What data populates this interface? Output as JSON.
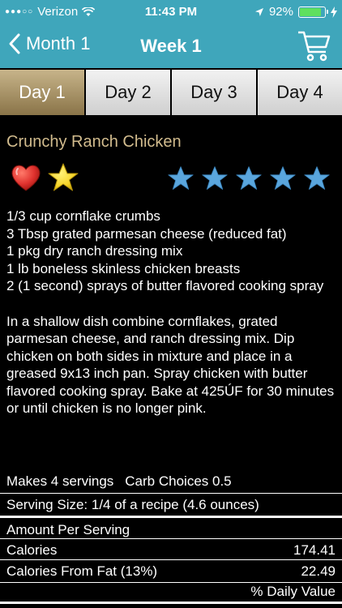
{
  "status_bar": {
    "carrier": "Verizon",
    "time": "11:43 PM",
    "battery": "92%",
    "battery_level": 0.92
  },
  "nav": {
    "back_label": "Month 1",
    "title": "Week 1",
    "icons": [
      "chevron-left-icon",
      "cart-icon"
    ]
  },
  "tabs": [
    {
      "label": "Day 1",
      "active": true
    },
    {
      "label": "Day 2",
      "active": false
    },
    {
      "label": "Day 3",
      "active": false
    },
    {
      "label": "Day 4",
      "active": false
    }
  ],
  "recipe": {
    "title": "Crunchy Ranch Chicken",
    "rating_stars": 5,
    "ingredients": [
      "1/3 cup cornflake crumbs",
      "3 Tbsp grated parmesan cheese (reduced fat)",
      "1 pkg dry ranch dressing mix",
      "1 lb boneless skinless chicken breasts",
      "2 (1 second) sprays of butter flavored cooking spray"
    ],
    "instructions": "In a shallow dish combine cornflakes, grated parmesan cheese, and ranch dressing mix. Dip chicken on both sides in mixture and place in a greased 9x13 inch pan.  Spray chicken with butter flavored cooking spray. Bake at 425ÚF for 30 minutes or until chicken is no longer pink.",
    "makes": "Makes 4 servings",
    "carb_choices": "Carb Choices 0.5"
  },
  "nutrition": {
    "serving_size": "Serving Size: 1/4 of a recipe (4.6 ounces)",
    "amount_header": "Amount Per Serving",
    "calories_label": "Calories",
    "calories_value": "174.41",
    "fat_cal_label": "Calories  From Fat (13%)",
    "fat_cal_value": "22.49",
    "daily_value_label": "% Daily Value"
  },
  "colors": {
    "bar": "#3fa6bb",
    "title_gold": "#d2bc8e",
    "star_blue": "#5aa6dd",
    "star_yellow": "#f6d427",
    "heart_red": "#e0322e"
  }
}
